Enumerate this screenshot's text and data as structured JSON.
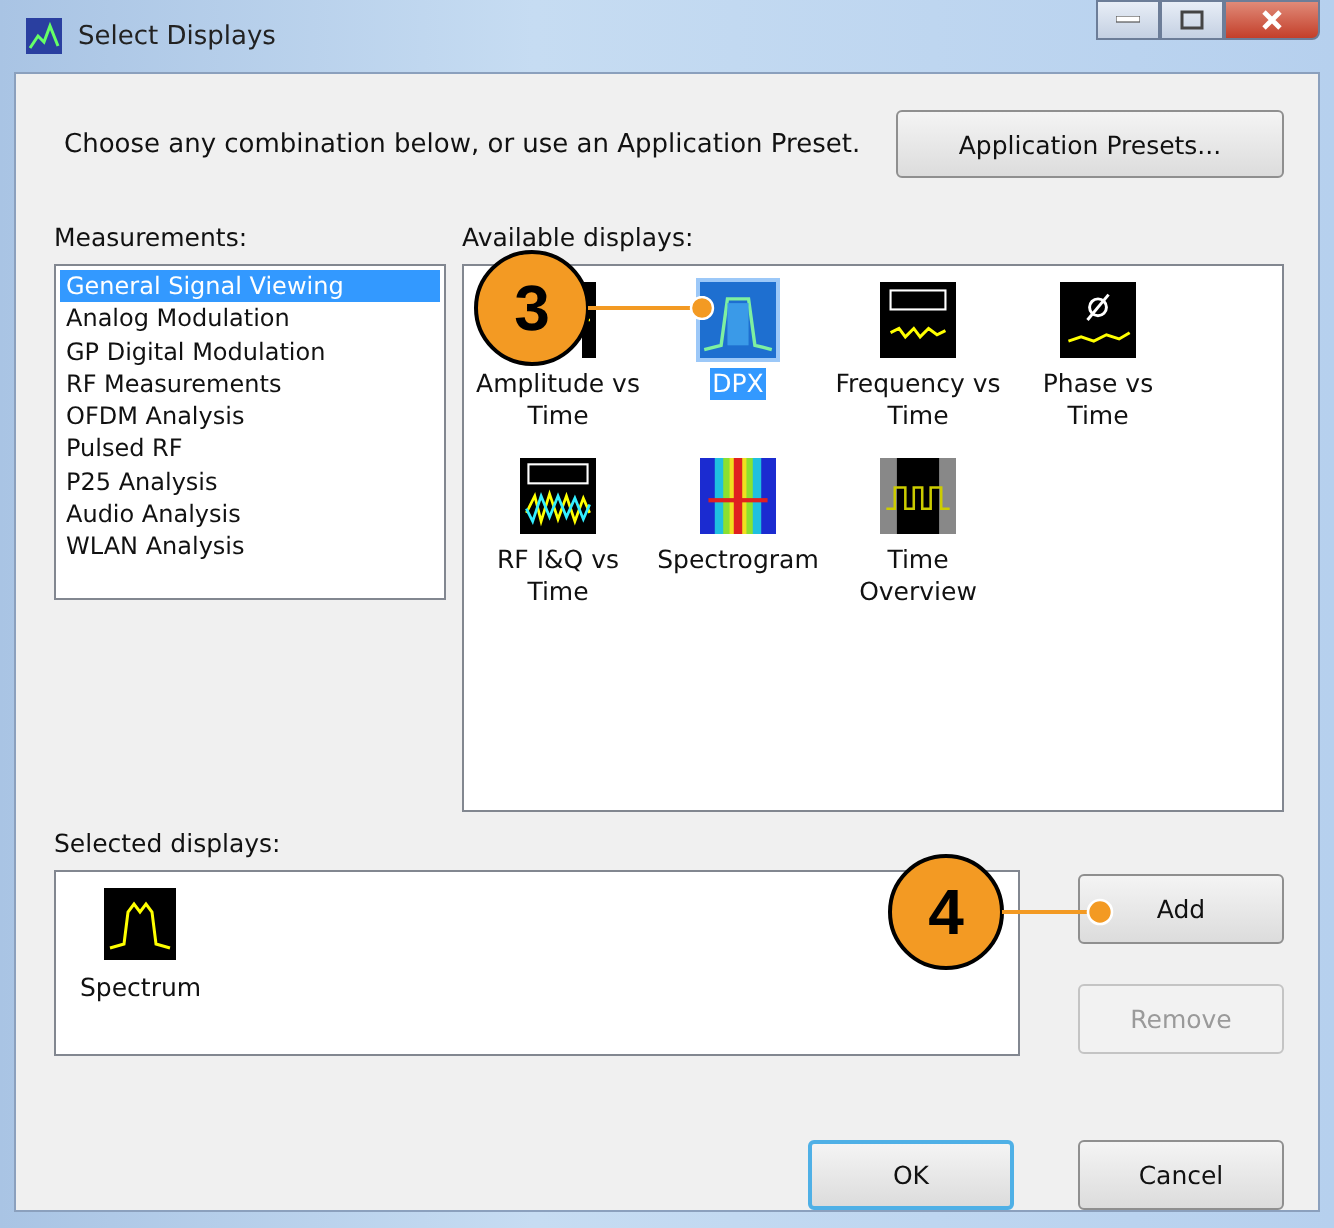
{
  "window": {
    "title": "Select Displays"
  },
  "instruction": "Choose any combination below, or use an Application Preset.",
  "presets_button": "Application Presets...",
  "measurements": {
    "label": "Measurements:",
    "items": [
      {
        "label": "General Signal Viewing",
        "selected": true
      },
      {
        "label": "Analog Modulation",
        "selected": false
      },
      {
        "label": "GP Digital Modulation",
        "selected": false
      },
      {
        "label": "RF Measurements",
        "selected": false
      },
      {
        "label": "OFDM Analysis",
        "selected": false
      },
      {
        "label": "Pulsed RF",
        "selected": false
      },
      {
        "label": "P25 Analysis",
        "selected": false
      },
      {
        "label": "Audio Analysis",
        "selected": false
      },
      {
        "label": "WLAN Analysis",
        "selected": false
      }
    ]
  },
  "available_displays": {
    "label": "Available displays:",
    "items": [
      {
        "label": "Amplitude vs Time",
        "kind": "amplitude",
        "selected": false
      },
      {
        "label": "DPX",
        "kind": "dpx",
        "selected": true
      },
      {
        "label": "Frequency vs Time",
        "kind": "frequency",
        "selected": false
      },
      {
        "label": "Phase vs Time",
        "kind": "phase",
        "selected": false
      },
      {
        "label": "RF I&Q vs Time",
        "kind": "iq",
        "selected": false
      },
      {
        "label": "Spectrogram",
        "kind": "spectrogram",
        "selected": false
      },
      {
        "label": "Time Overview",
        "kind": "overview",
        "selected": false
      }
    ]
  },
  "selected_displays": {
    "label": "Selected displays:",
    "items": [
      {
        "label": "Spectrum",
        "kind": "spectrum"
      }
    ]
  },
  "buttons": [
    {
      "label": "Add",
      "kind": "add",
      "disabled": false
    },
    {
      "label": "Remove",
      "kind": "remove",
      "disabled": true
    },
    {
      "label": "OK",
      "kind": "ok",
      "disabled": false
    },
    {
      "label": "Cancel",
      "kind": "cancel",
      "disabled": false
    }
  ],
  "callouts": [
    {
      "number": "3"
    },
    {
      "number": "4"
    }
  ]
}
